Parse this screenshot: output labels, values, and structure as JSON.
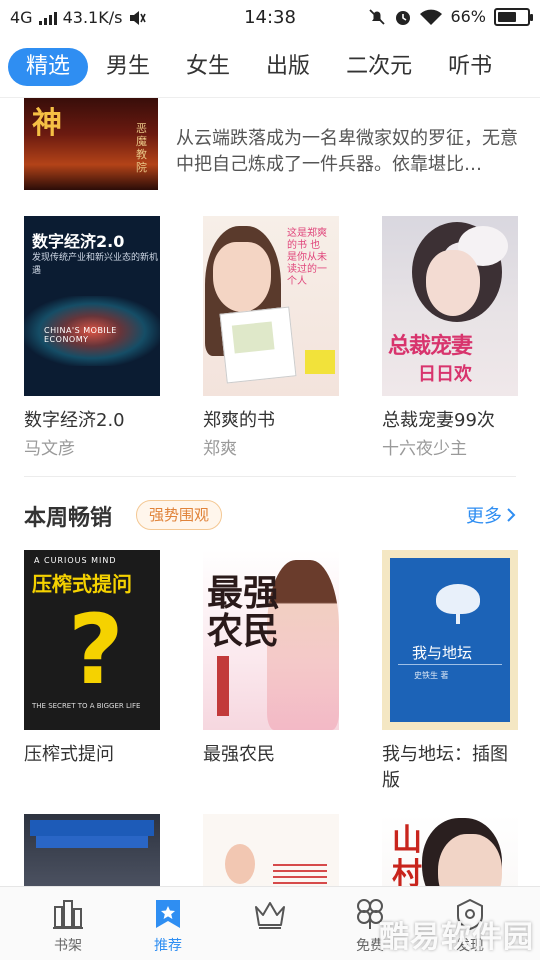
{
  "status_bar": {
    "network": "4G",
    "speed": "43.1K/s",
    "time": "14:38",
    "battery": "66%",
    "battery_level": 0.66
  },
  "tabs": [
    {
      "label": "精选",
      "active": true
    },
    {
      "label": "男生",
      "active": false
    },
    {
      "label": "女生",
      "active": false
    },
    {
      "label": "出版",
      "active": false
    },
    {
      "label": "二次元",
      "active": false
    },
    {
      "label": "听书",
      "active": false
    }
  ],
  "top_item": {
    "cover_glyph": "神",
    "cover_side": "恶魔教院",
    "description": "从云端跌落成为一名卑微家奴的罗征，无意中把自己炼成了一件兵器。依靠堪比…"
  },
  "row1": [
    {
      "title": "数字经济2.0",
      "author": "马文彦",
      "cover_title": "数字经济2.0",
      "cover_sub": "发现传统产业和新兴业态的新机遇",
      "cover_en": "CHINA'S MOBILE ECONOMY"
    },
    {
      "title": "郑爽的书",
      "author": "郑爽",
      "cover_blurb": "这是郑爽的书 也是你从未读过的一个人"
    },
    {
      "title": "总裁宠妻99次",
      "author": "十六夜少主",
      "cover_title": "总裁宠妻",
      "cover_sub": "日日欢"
    }
  ],
  "weekly": {
    "title": "本周畅销",
    "badge": "强势围观",
    "more": "更多"
  },
  "row2": [
    {
      "title": "压榨式提问",
      "cover_top": "A CURIOUS MIND",
      "cover_title": "压榨式提问",
      "cover_q": "?",
      "cover_bottom": "THE SECRET TO A BIGGER LIFE"
    },
    {
      "title": "最强农民",
      "cover_title": "最强农民"
    },
    {
      "title": "我与地坛：插图版",
      "cover_title": "我与地坛",
      "cover_author": "史铁生 著"
    }
  ],
  "row3": [
    {
      "cover_text": ""
    },
    {
      "cover_text": ""
    },
    {
      "cover_title": "山村"
    }
  ],
  "bottom_nav": [
    {
      "label": "书架",
      "icon": "bookshelf-icon",
      "active": false
    },
    {
      "label": "推荐",
      "icon": "star-bookmark-icon",
      "active": true
    },
    {
      "label": "",
      "icon": "crown-icon",
      "active": false
    },
    {
      "label": "免费",
      "icon": "clover-icon",
      "active": false
    },
    {
      "label": "发现",
      "icon": "compass-icon",
      "active": false
    }
  ],
  "watermark": "酷易软件园",
  "colors": {
    "accent": "#2f8ef2",
    "badge_text": "#e0833a",
    "text": "#333333",
    "muted": "#9a9a9a"
  }
}
